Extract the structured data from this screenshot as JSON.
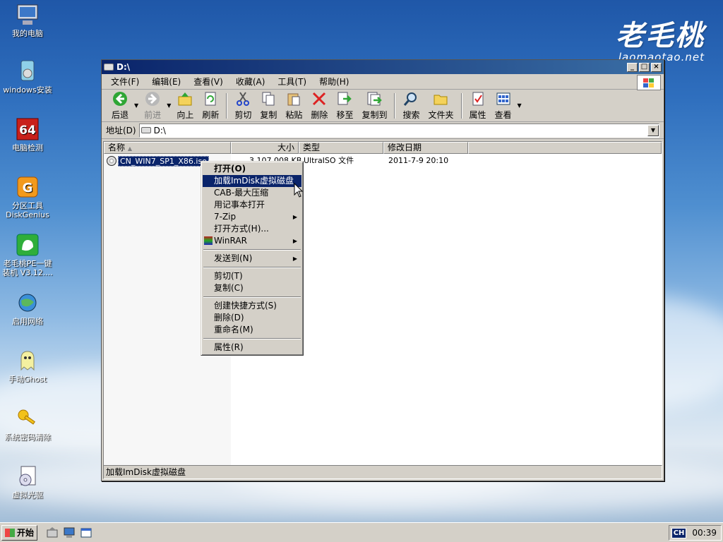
{
  "brand": {
    "title": "老毛桃",
    "url": "laomaotao.net"
  },
  "desktop_icons": [
    {
      "label": "我的电脑",
      "icon": "computer-icon"
    },
    {
      "label": "windows安装",
      "icon": "installer-icon"
    },
    {
      "label": "电脑检测",
      "icon": "64-icon"
    },
    {
      "label": "分区工具DiskGenius",
      "icon": "diskgenius-icon"
    },
    {
      "label": "老毛桃PE一键装机 V3.12....",
      "icon": "laomaotao-icon"
    },
    {
      "label": "启用网络",
      "icon": "network-icon"
    },
    {
      "label": "手动Ghost",
      "icon": "ghost-icon"
    },
    {
      "label": "系统密码清除",
      "icon": "key-icon"
    },
    {
      "label": "虚拟光驱",
      "icon": "virtual-drive-icon"
    }
  ],
  "window": {
    "title": "D:\\",
    "menu": [
      "文件(F)",
      "编辑(E)",
      "查看(V)",
      "收藏(A)",
      "工具(T)",
      "帮助(H)"
    ],
    "toolbar": {
      "back": "后退",
      "forward": "前进",
      "up": "向上",
      "refresh": "刷新",
      "cut": "剪切",
      "copy": "复制",
      "paste": "粘贴",
      "delete": "删除",
      "move_to": "移至",
      "copy_to": "复制到",
      "search": "搜索",
      "folders": "文件夹",
      "properties": "属性",
      "views": "查看"
    },
    "address": {
      "label": "地址(D)",
      "value": "D:\\"
    },
    "columns": {
      "name": "名称",
      "size": "大小",
      "type": "类型",
      "modified": "修改日期"
    },
    "files": [
      {
        "name": "CN_WIN7_SP1_X86.iso",
        "size": "3,107,008 KB",
        "type": "UltraISO 文件",
        "modified": "2011-7-9 20:10"
      }
    ],
    "status": "加载ImDisk虚拟磁盘"
  },
  "context_menu": {
    "open": "打开(O)",
    "imdisk": "加载ImDisk虚拟磁盘",
    "cab": "CAB-最大压缩",
    "notepad": "用记事本打开",
    "zip": "7-Zip",
    "open_with": "打开方式(H)...",
    "winrar": "WinRAR",
    "send_to": "发送到(N)",
    "cut": "剪切(T)",
    "copy": "复制(C)",
    "shortcut": "创建快捷方式(S)",
    "delete": "删除(D)",
    "rename": "重命名(M)",
    "properties": "属性(R)"
  },
  "taskbar": {
    "start": "开始",
    "lang": "CH",
    "clock": "00:39"
  },
  "colors": {
    "title_bar": "#0a246a",
    "selection": "#0a246a",
    "face": "#d4d0c8"
  }
}
